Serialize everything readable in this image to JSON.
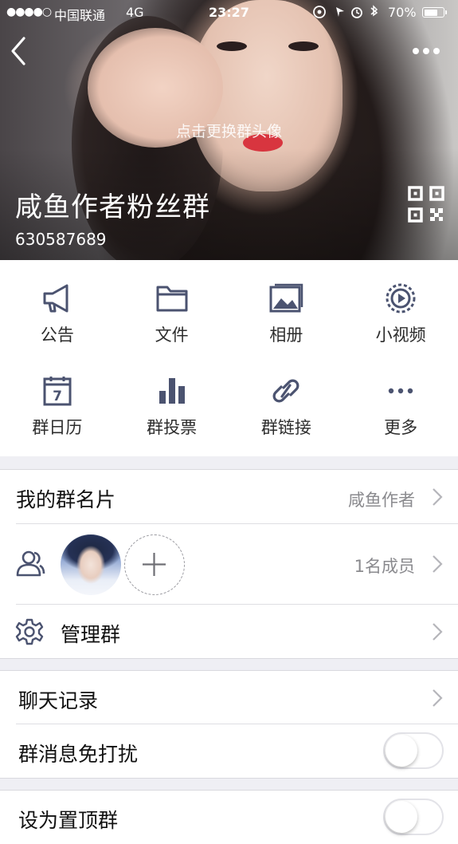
{
  "status_bar": {
    "signal": "●●●●○",
    "carrier": "中国联通",
    "network": "4G",
    "time": "23:27",
    "battery_percent": "70%",
    "battery_level": 0.7
  },
  "header": {
    "change_avatar_hint": "点击更换群头像",
    "group_name": "咸鱼作者粉丝群",
    "group_id": "630587689"
  },
  "grid": {
    "items": [
      {
        "label": "公告",
        "icon": "megaphone-icon"
      },
      {
        "label": "文件",
        "icon": "folder-icon"
      },
      {
        "label": "相册",
        "icon": "photo-album-icon"
      },
      {
        "label": "小视频",
        "icon": "video-play-icon"
      },
      {
        "label": "群日历",
        "icon": "calendar-icon",
        "icon_text": "7"
      },
      {
        "label": "群投票",
        "icon": "bar-chart-icon"
      },
      {
        "label": "群链接",
        "icon": "link-icon"
      },
      {
        "label": "更多",
        "icon": "more-dots-icon"
      }
    ]
  },
  "settings": {
    "my_card_label": "我的群名片",
    "my_card_value": "咸鱼作者",
    "members_value": "1名成员",
    "manage_label": "管理群",
    "chat_history_label": "聊天记录",
    "mute_label": "群消息免打扰",
    "mute_on": false,
    "pin_label": "设为置顶群",
    "pin_on": false
  },
  "colors": {
    "background": "#efeff4",
    "text_primary": "#111111",
    "text_secondary": "#8a8a8e",
    "icon": "#4b5370"
  }
}
